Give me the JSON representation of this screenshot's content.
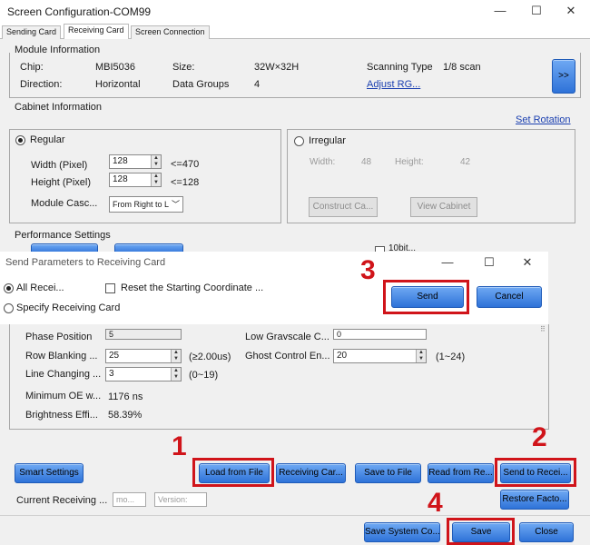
{
  "window": {
    "title": "Screen Configuration-COM99",
    "controls": {
      "minimize": "—",
      "maximize": "☐",
      "close": "✕"
    }
  },
  "tabs": [
    {
      "label": "Sending Card",
      "active": false
    },
    {
      "label": "Receiving Card",
      "active": true
    },
    {
      "label": "Screen Connection",
      "active": false
    }
  ],
  "module_info": {
    "title": "Module Information",
    "chip_label": "Chip:",
    "chip_value": "MBI5036",
    "size_label": "Size:",
    "size_value": "32W×32H",
    "scan_label": "Scanning Type",
    "scan_value": "1/8 scan",
    "direction_label": "Direction:",
    "direction_value": "Horizontal",
    "groups_label": "Data Groups",
    "groups_value": "4",
    "adjust_link": "Adjust RG...",
    "more_button": ">>"
  },
  "cabinet": {
    "title": "Cabinet Information",
    "set_rotation": "Set Rotation",
    "regular_label": "Regular",
    "width_label": "Width (Pixel)",
    "width_value": "128",
    "width_max": "<=470",
    "height_label": "Height (Pixel)",
    "height_value": "128",
    "height_max": "<=128",
    "cascade_label": "Module Casc...",
    "cascade_value": "From Right to L",
    "irregular_label": "Irregular",
    "irr_width_label": "Width:",
    "irr_width_value": "48",
    "irr_height_label": "Height:",
    "irr_height_value": "42",
    "construct_btn": "Construct Ca...",
    "view_btn": "View Cabinet"
  },
  "performance": {
    "title": "Performance Settings",
    "partial_label": "10bit..."
  },
  "dialog": {
    "title": "Send Parameters to Receiving Card",
    "controls": {
      "minimize": "—",
      "maximize": "☐",
      "close": "✕"
    },
    "all_label": "All Recei...",
    "reset_label": "Reset the Starting Coordinate ...",
    "specify_label": "Specify Receiving Card",
    "send_btn": "Send",
    "cancel_btn": "Cancel"
  },
  "params": {
    "phase_label": "Phase Position",
    "phase_value": "5",
    "low_gray_label": "Low Grayscale C...",
    "low_gray_value": "0",
    "row_blank_label": "Row Blanking ...",
    "row_blank_value": "25",
    "row_blank_note": "(≥2.00us)",
    "ghost_label": "Ghost Control En...",
    "ghost_value": "20",
    "ghost_range": "(1~24)",
    "line_change_label": "Line Changing ...",
    "line_change_value": "3",
    "line_change_range": "(0~19)",
    "min_oe_label": "Minimum OE w...",
    "min_oe_value": "1176 ns",
    "brightness_label": "Brightness Effi...",
    "brightness_value": "58.39%"
  },
  "bottom": {
    "smart_settings": "Smart Settings",
    "load_from_file": "Load from File",
    "receiving_card": "Receiving Car...",
    "save_to_file": "Save to File",
    "read_from_re": "Read from Re...",
    "send_to_recei": "Send to Recei...",
    "current_label": "Current Receiving ...",
    "model_placeholder": "mo...",
    "version_placeholder": "Version:",
    "restore_factory": "Restore Facto...",
    "save_system": "Save System Co...",
    "save": "Save",
    "close": "Close"
  },
  "markers": {
    "m1": "1",
    "m2": "2",
    "m3": "3",
    "m4": "4"
  }
}
